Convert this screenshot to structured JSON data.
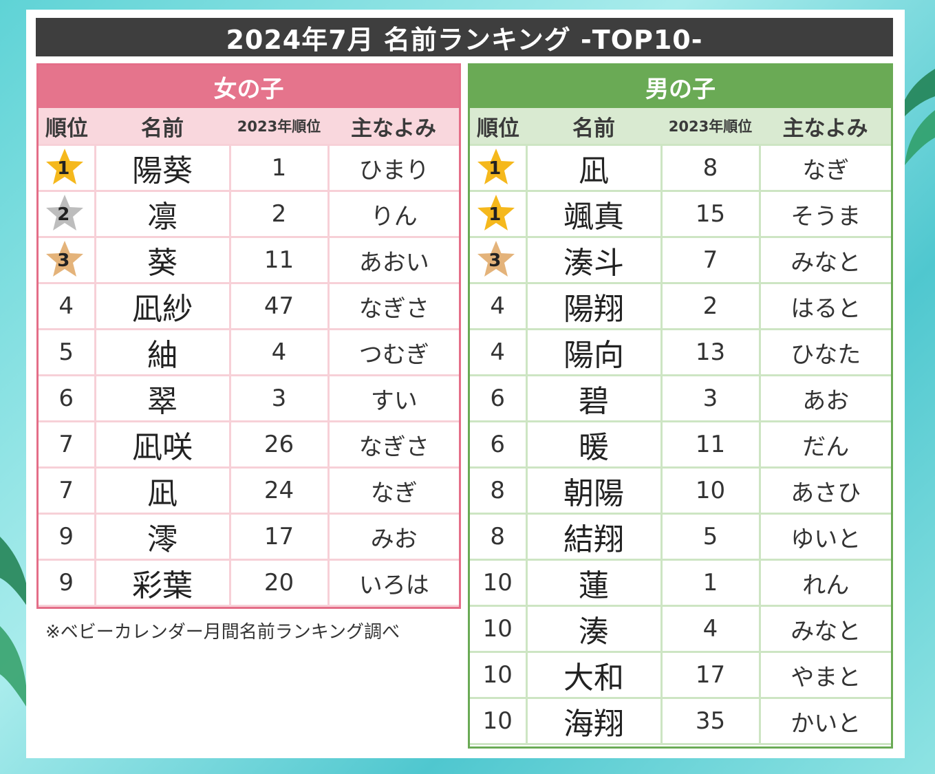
{
  "title": "2024年7月 名前ランキング -TOP10-",
  "note": "※ベビーカレンダー月間名前ランキング調べ",
  "colors": {
    "girls_accent": "#e5748c",
    "boys_accent": "#6aaa55",
    "gold": "#f5b81c",
    "silver": "#bdbdbd",
    "bronze": "#e4b37a"
  },
  "headers": {
    "rank": "順位",
    "name": "名前",
    "prev": "2023年順位",
    "reading": "主なよみ"
  },
  "girls": {
    "label": "女の子",
    "rows": [
      {
        "rank": "1",
        "medal": "gold",
        "name": "陽葵",
        "prev": "1",
        "reading": "ひまり"
      },
      {
        "rank": "2",
        "medal": "silver",
        "name": "凛",
        "prev": "2",
        "reading": "りん"
      },
      {
        "rank": "3",
        "medal": "bronze",
        "name": "葵",
        "prev": "11",
        "reading": "あおい"
      },
      {
        "rank": "4",
        "medal": "",
        "name": "凪紗",
        "prev": "47",
        "reading": "なぎさ"
      },
      {
        "rank": "5",
        "medal": "",
        "name": "紬",
        "prev": "4",
        "reading": "つむぎ"
      },
      {
        "rank": "6",
        "medal": "",
        "name": "翠",
        "prev": "3",
        "reading": "すい"
      },
      {
        "rank": "7",
        "medal": "",
        "name": "凪咲",
        "prev": "26",
        "reading": "なぎさ"
      },
      {
        "rank": "7",
        "medal": "",
        "name": "凪",
        "prev": "24",
        "reading": "なぎ"
      },
      {
        "rank": "9",
        "medal": "",
        "name": "澪",
        "prev": "17",
        "reading": "みお"
      },
      {
        "rank": "9",
        "medal": "",
        "name": "彩葉",
        "prev": "20",
        "reading": "いろは"
      }
    ]
  },
  "boys": {
    "label": "男の子",
    "rows": [
      {
        "rank": "1",
        "medal": "gold",
        "name": "凪",
        "prev": "8",
        "reading": "なぎ"
      },
      {
        "rank": "1",
        "medal": "gold",
        "name": "颯真",
        "prev": "15",
        "reading": "そうま"
      },
      {
        "rank": "3",
        "medal": "bronze",
        "name": "湊斗",
        "prev": "7",
        "reading": "みなと"
      },
      {
        "rank": "4",
        "medal": "",
        "name": "陽翔",
        "prev": "2",
        "reading": "はると"
      },
      {
        "rank": "4",
        "medal": "",
        "name": "陽向",
        "prev": "13",
        "reading": "ひなた"
      },
      {
        "rank": "6",
        "medal": "",
        "name": "碧",
        "prev": "3",
        "reading": "あお"
      },
      {
        "rank": "6",
        "medal": "",
        "name": "暖",
        "prev": "11",
        "reading": "だん"
      },
      {
        "rank": "8",
        "medal": "",
        "name": "朝陽",
        "prev": "10",
        "reading": "あさひ"
      },
      {
        "rank": "8",
        "medal": "",
        "name": "結翔",
        "prev": "5",
        "reading": "ゆいと"
      },
      {
        "rank": "10",
        "medal": "",
        "name": "蓮",
        "prev": "1",
        "reading": "れん"
      },
      {
        "rank": "10",
        "medal": "",
        "name": "湊",
        "prev": "4",
        "reading": "みなと"
      },
      {
        "rank": "10",
        "medal": "",
        "name": "大和",
        "prev": "17",
        "reading": "やまと"
      },
      {
        "rank": "10",
        "medal": "",
        "name": "海翔",
        "prev": "35",
        "reading": "かいと"
      }
    ]
  }
}
